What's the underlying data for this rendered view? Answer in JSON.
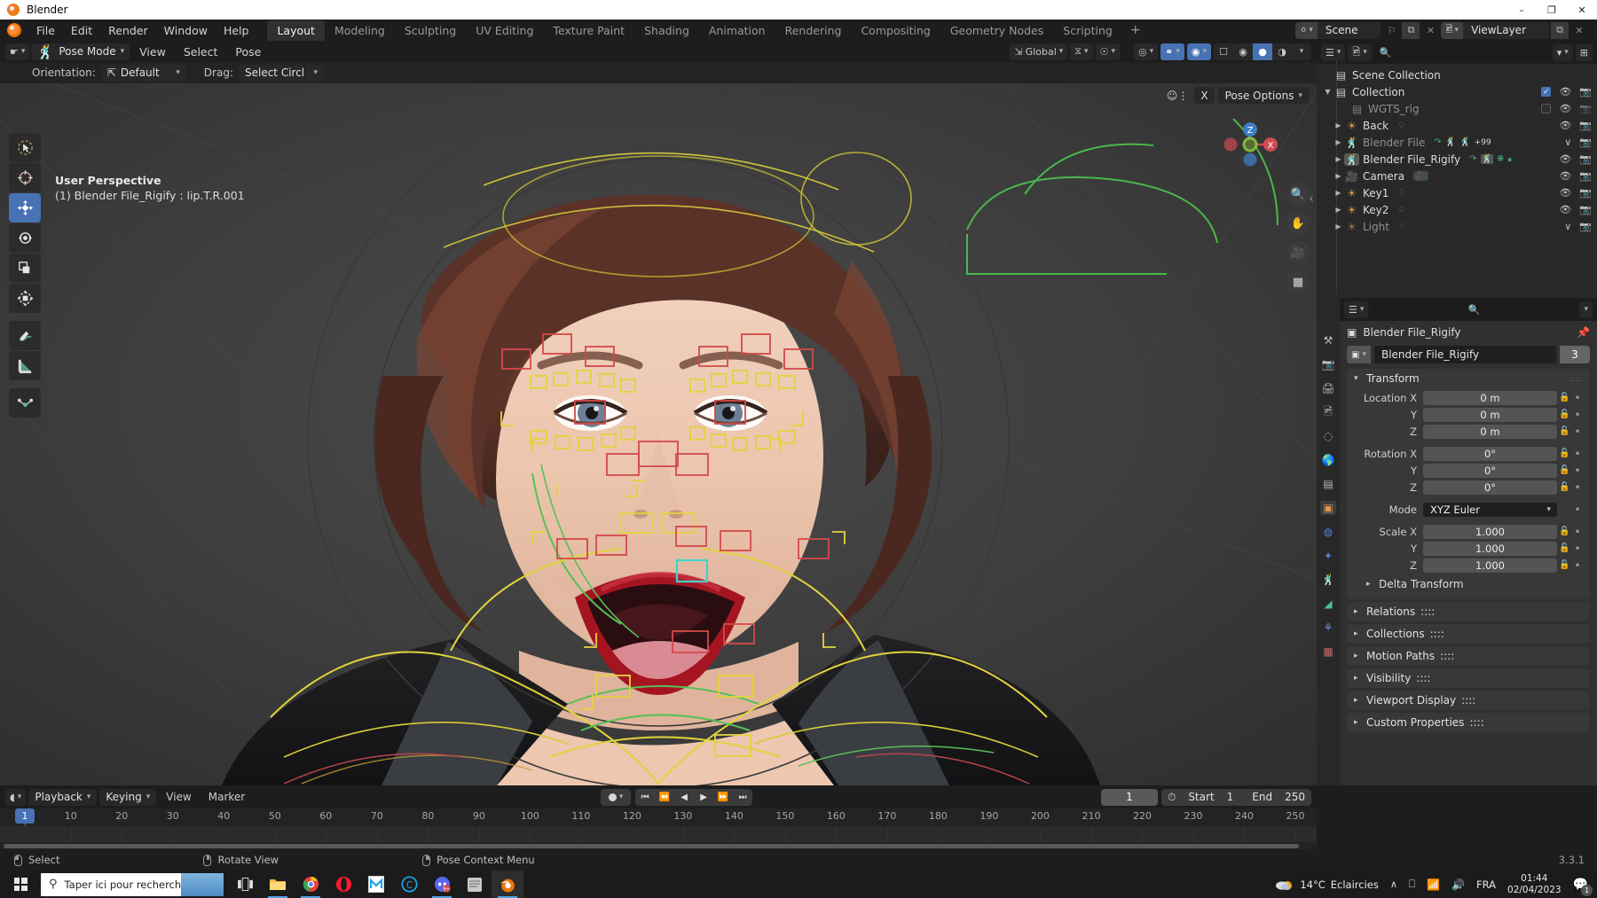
{
  "window": {
    "title": "Blender",
    "minimize": "–",
    "maximize": "❐",
    "close": "✕"
  },
  "topbar": {
    "menus": [
      "File",
      "Edit",
      "Render",
      "Window",
      "Help"
    ],
    "workspaces": [
      {
        "label": "Layout",
        "active": true
      },
      {
        "label": "Modeling",
        "active": false
      },
      {
        "label": "Sculpting",
        "active": false
      },
      {
        "label": "UV Editing",
        "active": false
      },
      {
        "label": "Texture Paint",
        "active": false
      },
      {
        "label": "Shading",
        "active": false
      },
      {
        "label": "Animation",
        "active": false
      },
      {
        "label": "Rendering",
        "active": false
      },
      {
        "label": "Compositing",
        "active": false
      },
      {
        "label": "Geometry Nodes",
        "active": false
      },
      {
        "label": "Scripting",
        "active": false
      }
    ],
    "add_workspace": "+",
    "scene_name": "Scene",
    "viewlayer_name": "ViewLayer",
    "new_scene_icon": "⧉",
    "unlink_icon": "✕",
    "pin_icon": "⚐"
  },
  "viewport": {
    "header": {
      "editor_type_icon": "pose-editor-icon",
      "mode": "Pose Mode",
      "menus": [
        "View",
        "Select",
        "Pose"
      ],
      "transform_orientation": "Global",
      "snap_icon": "magnet-icon",
      "proportional_icon": "proportional-edit-icon"
    },
    "tool_header": {
      "orientation_label": "Orientation:",
      "orientation_value": "Default",
      "drag_label": "Drag:",
      "drag_value": "Select Circl"
    },
    "overlay_text_line1": "User Perspective",
    "overlay_text_line2": "(1) Blender File_Rigify : lip.T.R.001",
    "pose_options_label": "Pose Options",
    "pose_x_label": "X",
    "gizmo_axes": {
      "x": "X",
      "z": "Z"
    },
    "tools": [
      {
        "name": "tweak-tool",
        "glyph": "➤",
        "active": false
      },
      {
        "name": "cursor-tool",
        "glyph": "⊕",
        "active": false
      },
      {
        "name": "move-tool",
        "glyph": "✥",
        "active": true
      },
      {
        "name": "rotate-tool",
        "glyph": "↻",
        "active": false
      },
      {
        "name": "scale-tool",
        "glyph": "◱",
        "active": false
      },
      {
        "name": "transform-tool",
        "glyph": "✣",
        "active": false
      },
      {
        "name": "annotate-tool",
        "glyph": "✎",
        "active": false
      },
      {
        "name": "measure-tool",
        "glyph": "◢",
        "active": false
      },
      {
        "name": "bendy-bone-tool",
        "glyph": "⁀",
        "active": false
      }
    ],
    "nav_buttons": [
      {
        "name": "zoom-nav-button",
        "glyph": "⌕"
      },
      {
        "name": "pan-nav-button",
        "glyph": "✋"
      },
      {
        "name": "camera-view-button",
        "glyph": "Ἲ5"
      },
      {
        "name": "ortho-toggle-button",
        "glyph": "▦"
      }
    ]
  },
  "outliner": {
    "display_mode_icon": "outliner-view-icon",
    "filter_icon": "filter-icon",
    "new_collection_icon": "new-collection-icon",
    "search_placeholder": "",
    "rows": [
      {
        "name": "Scene Collection",
        "indent": 0,
        "tri": "",
        "icon": "▤",
        "icon_color": "#c8c8c8",
        "dim": false,
        "checkbox": null,
        "eye": false,
        "camera": false,
        "badges": []
      },
      {
        "name": "Collection",
        "indent": 1,
        "tri": "▼",
        "icon": "▤",
        "icon_color": "#c8c8c8",
        "dim": false,
        "checkbox": true,
        "eye": true,
        "camera": true,
        "badges": []
      },
      {
        "name": "WGTS_rig",
        "indent": 2,
        "tri": "",
        "icon": "▤",
        "icon_color": "#8a8a8a",
        "dim": true,
        "checkbox": false,
        "eye": true,
        "camera": true,
        "badges": []
      },
      {
        "name": "Back",
        "indent": 2,
        "tri": "▶",
        "icon": "◉",
        "icon_color": "#e09b4f",
        "dim": false,
        "checkbox": null,
        "eye": true,
        "camera": true,
        "badges": [
          {
            "glyph": "◢",
            "color": "#4aa582"
          }
        ]
      },
      {
        "name": "Blender File",
        "indent": 2,
        "tri": "▶",
        "icon": "人",
        "icon_color": "#e09b4f",
        "dim": true,
        "checkbox": null,
        "eye": true,
        "camera": true,
        "badges": [
          {
            "glyph": "↷",
            "color": "#4aa582"
          },
          {
            "glyph": "人",
            "color": "#4aa582"
          },
          {
            "glyph": "人",
            "color": "#4aa582"
          },
          {
            "glyph": "+99",
            "color": "#cfcfcf"
          }
        ]
      },
      {
        "name": "Blender File_Rigify",
        "indent": 2,
        "tri": "▶",
        "icon": "人",
        "icon_color": "#e09b4f",
        "dim": false,
        "checkbox": null,
        "eye": true,
        "camera": true,
        "selected": true,
        "badges": [
          {
            "glyph": "↷",
            "color": "#4aa582"
          },
          {
            "glyph": "人",
            "color": "#4aa582"
          },
          {
            "glyph": "✶",
            "color": "#4aa582"
          },
          {
            "glyph": "▫",
            "color": "#4aa582"
          }
        ]
      },
      {
        "name": "Camera",
        "indent": 2,
        "tri": "▶",
        "icon": "Ἲ5",
        "icon_color": "#e09b4f",
        "dim": false,
        "checkbox": null,
        "eye": true,
        "camera": true,
        "badges": [
          {
            "glyph": "▣",
            "color": "#4aa582"
          }
        ]
      },
      {
        "name": "Key1",
        "indent": 2,
        "tri": "▶",
        "icon": "◉",
        "icon_color": "#e09b4f",
        "dim": false,
        "checkbox": null,
        "eye": true,
        "camera": true,
        "badges": [
          {
            "glyph": "◢",
            "color": "#4aa582"
          }
        ]
      },
      {
        "name": "Key2",
        "indent": 2,
        "tri": "▶",
        "icon": "◉",
        "icon_color": "#e09b4f",
        "dim": false,
        "checkbox": null,
        "eye": true,
        "camera": true,
        "badges": [
          {
            "glyph": "◢",
            "color": "#4aa582"
          }
        ]
      },
      {
        "name": "Light",
        "indent": 2,
        "tri": "▶",
        "icon": "◉",
        "icon_color": "#9a7a55",
        "dim": true,
        "checkbox": null,
        "eye": false,
        "camera": true,
        "badges": [
          {
            "glyph": "○",
            "color": "#3e7a64"
          }
        ]
      }
    ]
  },
  "properties": {
    "search_placeholder": "",
    "breadcrumb": "Blender File_Rigify",
    "id_name": "Blender File_Rigify",
    "id_users": "3",
    "tabs": [
      {
        "name": "tool-tab",
        "glyph": "⚒",
        "active": false
      },
      {
        "name": "render-tab",
        "glyph": "὏7",
        "active": false
      },
      {
        "name": "output-tab",
        "glyph": "὚8",
        "active": false
      },
      {
        "name": "viewlayer-tab",
        "glyph": "Ὓc",
        "active": false
      },
      {
        "name": "scene-tab",
        "glyph": "◔",
        "active": false
      },
      {
        "name": "world-tab",
        "glyph": "ἱ0",
        "active": false
      },
      {
        "name": "collection-tab",
        "glyph": "▤",
        "active": false
      },
      {
        "name": "object-tab",
        "glyph": "▣",
        "active": true
      },
      {
        "name": "modifiers-tab",
        "glyph": "ὒ7",
        "active": false
      },
      {
        "name": "physics-tab",
        "glyph": "✦",
        "active": false
      },
      {
        "name": "object-constraints-tab",
        "glyph": "人",
        "active": false
      },
      {
        "name": "object-data-tab",
        "glyph": "⁂",
        "active": false
      },
      {
        "name": "bone-tab",
        "glyph": "⚘",
        "active": false
      },
      {
        "name": "texture-tab",
        "glyph": "▦",
        "active": false
      }
    ],
    "transform": {
      "title": "Transform",
      "fields": [
        {
          "label": "Location X",
          "value": "0 m"
        },
        {
          "label": "Y",
          "value": "0 m"
        },
        {
          "label": "Z",
          "value": "0 m"
        },
        {
          "label": "Rotation X",
          "value": "0°"
        },
        {
          "label": "Y",
          "value": "0°"
        },
        {
          "label": "Z",
          "value": "0°"
        }
      ],
      "mode_label": "Mode",
      "mode_value": "XYZ Euler",
      "scale": [
        {
          "label": "Scale X",
          "value": "1.000"
        },
        {
          "label": "Y",
          "value": "1.000"
        },
        {
          "label": "Z",
          "value": "1.000"
        }
      ],
      "delta_transform": "Delta Transform"
    },
    "panels": [
      "Relations",
      "Collections",
      "Motion Paths",
      "Visibility",
      "Viewport Display",
      "Custom Properties"
    ]
  },
  "timeline": {
    "editor_icon": "timeline-editor-icon",
    "menus_drop": [
      "Playback",
      "Keying"
    ],
    "menus": [
      "View",
      "Marker"
    ],
    "record_icon": "record-keyframe-icon",
    "transport": [
      "⏮",
      "⏪",
      "◀",
      "▶",
      "⏩",
      "⏭"
    ],
    "current_frame": "1",
    "start_label": "Start",
    "start_value": "1",
    "end_label": "End",
    "end_value": "250",
    "ticks": [
      1,
      10,
      20,
      30,
      40,
      50,
      60,
      70,
      80,
      90,
      100,
      110,
      120,
      130,
      140,
      150,
      160,
      170,
      180,
      190,
      200,
      210,
      220,
      230,
      240,
      250
    ],
    "playhead_frame": 1
  },
  "statusbar": {
    "items": [
      {
        "mouse": "left",
        "label": "Select"
      },
      {
        "mouse": "middle",
        "label": "Rotate View"
      },
      {
        "mouse": "right",
        "label": "Pose Context Menu"
      }
    ],
    "version": "3.3.1"
  },
  "taskbar": {
    "search_placeholder": "Taper ici pour rechercher",
    "search_icon": "search-icon",
    "start_icon": "windows-start-icon",
    "task_view_icon": "task-view-icon",
    "apps": [
      {
        "name": "file-explorer-icon",
        "glyph": "Ὄ1",
        "color": "#f0b429",
        "active": false,
        "running": true
      },
      {
        "name": "chrome-icon",
        "glyph": "●",
        "color": "#e94235",
        "active": false,
        "running": true
      },
      {
        "name": "opera-icon",
        "glyph": "O",
        "color": "#ff1b2d",
        "active": false,
        "running": false
      },
      {
        "name": "mega-icon",
        "glyph": "M",
        "color": "#ffffff",
        "active": false,
        "running": false
      },
      {
        "name": "copernic-icon",
        "glyph": "C",
        "color": "#1fa5e8",
        "active": false,
        "running": false
      },
      {
        "name": "discord-icon",
        "glyph": "●",
        "color": "#5865f2",
        "active": false,
        "running": true,
        "badge": "9+"
      },
      {
        "name": "notes-icon",
        "glyph": "Ὅ3",
        "color": "#c9c9c9",
        "active": false,
        "running": false
      },
      {
        "name": "blender-taskbar-icon",
        "glyph": "●",
        "color": "#ea7600",
        "active": true,
        "running": true
      }
    ],
    "weather_temp": "14°C",
    "weather_text": "Eclaircies",
    "tray_show_hidden": "∧",
    "tray_items": [
      "⬚",
      "὏6",
      "ὐa"
    ],
    "language": "FRA",
    "time": "01:44",
    "date": "02/04/2023",
    "notification_count": "1"
  },
  "colors": {
    "accent_blue": "#4772b3",
    "blender_orange": "#ea7600",
    "axis_x": "#cf4a52",
    "axis_z": "#3d7ec4"
  }
}
